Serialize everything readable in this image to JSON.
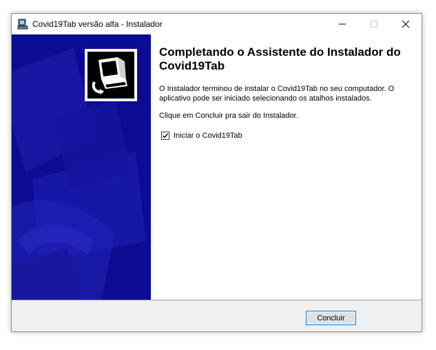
{
  "window": {
    "title": "Covid19Tab versão alfa - Instalador"
  },
  "wizard": {
    "heading": "Completando o Assistente do Instalador do Covid19Tab",
    "paragraph1": "O Instalador terminou de instalar o Covid19Tab no seu computador. O aplicativo pode ser iniciado selecionando os atalhos instalados.",
    "paragraph2": "Clique em Concluir pra sair do Instalador.",
    "launch_checkbox": {
      "label": "Iniciar o Covid19Tab",
      "checked": true
    }
  },
  "footer": {
    "finish_label": "Concluir"
  },
  "colors": {
    "side_panel": "#0d0d96",
    "accent_border": "#0078d7"
  },
  "icons": {
    "app": "installer-icon",
    "minimize": "minimize-icon",
    "maximize": "maximize-icon",
    "close": "close-icon",
    "logo": "computer-install-icon",
    "check": "check-icon"
  }
}
